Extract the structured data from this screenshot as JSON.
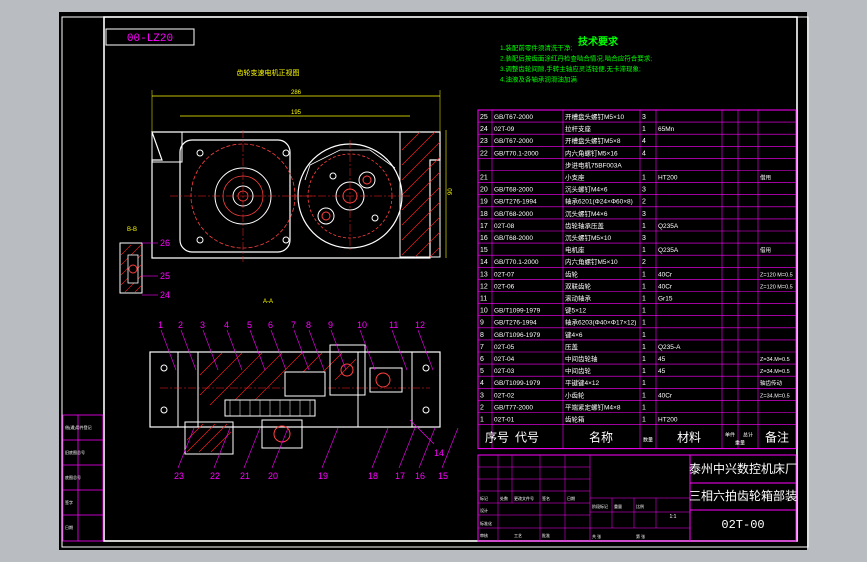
{
  "drawing": {
    "code_box": "00-LZ20",
    "title_note": "齿轮变速电机正视图",
    "tech_title": "技术要求",
    "tech_lines": [
      "1.装配前零件须清洗干净;",
      "2.装配后按齿面涂红丹检查啮合情况,啮合应符合要求;",
      "3.调整齿轮间隙,手转主轴应灵活轻便,无卡滞现象;",
      "4.油液及各轴承润滑油加满"
    ],
    "view_bb": "B-B",
    "view_aa": "A-A",
    "dim_top": "286",
    "dim_mid": "195",
    "dim_left": "90",
    "top_callouts": [
      "1",
      "2",
      "3",
      "4",
      "5",
      "6",
      "7",
      "8",
      "9",
      "10",
      "11",
      "12"
    ],
    "bottom_callouts": [
      "23",
      "22",
      "21",
      "20",
      "19",
      "18",
      "17",
      "16",
      "15"
    ],
    "side_callouts": [
      "14"
    ],
    "bb_callouts": [
      "26",
      "25",
      "24"
    ]
  },
  "bom": {
    "rows": [
      {
        "no": "25",
        "code": "GB/T67-2000",
        "name": "开槽盘头螺钉M5×10",
        "qty": "3",
        "mat": "",
        "note": ""
      },
      {
        "no": "24",
        "code": "02T-09",
        "name": "拉杆支座",
        "qty": "1",
        "mat": "65Mn",
        "note": ""
      },
      {
        "no": "23",
        "code": "GB/T67-2000",
        "name": "开槽盘头螺钉M5×8",
        "qty": "4",
        "mat": "",
        "note": ""
      },
      {
        "no": "22",
        "code": "GB/T70.1-2000",
        "name": "内六角螺钉M5×16",
        "qty": "4",
        "mat": "",
        "note": ""
      },
      {
        "no": "",
        "code": "",
        "name": "步进电机75BF003A",
        "qty": "",
        "mat": "",
        "note": ""
      },
      {
        "no": "21",
        "code": "",
        "name": "小支座",
        "qty": "1",
        "mat": "HT200",
        "note": "借用"
      },
      {
        "no": "20",
        "code": "GB/T68-2000",
        "name": "沉头螺钉M4×6",
        "qty": "3",
        "mat": "",
        "note": ""
      },
      {
        "no": "19",
        "code": "GB/T276-1994",
        "name": "轴承6201(Φ24×Φ60×8)",
        "qty": "2",
        "mat": "",
        "note": ""
      },
      {
        "no": "18",
        "code": "GB/T68-2000",
        "name": "沉头螺钉M4×6",
        "qty": "3",
        "mat": "",
        "note": ""
      },
      {
        "no": "17",
        "code": "02T-08",
        "name": "齿轮轴承压盖",
        "qty": "1",
        "mat": "Q235A",
        "note": ""
      },
      {
        "no": "16",
        "code": "GB/T68-2000",
        "name": "沉头螺钉M5×10",
        "qty": "3",
        "mat": "",
        "note": ""
      },
      {
        "no": "15",
        "code": "",
        "name": "电机座",
        "qty": "1",
        "mat": "Q235A",
        "note": "借用"
      },
      {
        "no": "14",
        "code": "GB/T70.1-2000",
        "name": "内六角螺钉M5×10",
        "qty": "2",
        "mat": "",
        "note": ""
      },
      {
        "no": "13",
        "code": "02T-07",
        "name": "齿轮",
        "qty": "1",
        "mat": "40Cr",
        "note": "Z=120 M=0.5"
      },
      {
        "no": "12",
        "code": "02T-06",
        "name": "双联齿轮",
        "qty": "1",
        "mat": "40Cr",
        "note": "Z=120 M=0.5"
      },
      {
        "no": "11",
        "code": "",
        "name": "滚动轴承",
        "qty": "1",
        "mat": "Gr15",
        "note": ""
      },
      {
        "no": "10",
        "code": "GB/T1099-1979",
        "name": "键5×12",
        "qty": "1",
        "mat": "",
        "note": ""
      },
      {
        "no": "9",
        "code": "GB/T276-1994",
        "name": "轴承6203(Φ40×Φ17×12)",
        "qty": "1",
        "mat": "",
        "note": ""
      },
      {
        "no": "8",
        "code": "GB/T1096-1979",
        "name": "键4×6",
        "qty": "1",
        "mat": "",
        "note": ""
      },
      {
        "no": "7",
        "code": "02T-05",
        "name": "压盖",
        "qty": "1",
        "mat": "Q235-A",
        "note": ""
      },
      {
        "no": "6",
        "code": "02T-04",
        "name": "中间齿轮轴",
        "qty": "1",
        "mat": "45",
        "note": "Z=34.M=0.5"
      },
      {
        "no": "5",
        "code": "02T-03",
        "name": "中间齿轮",
        "qty": "1",
        "mat": "45",
        "note": "Z=34.M=0.5"
      },
      {
        "no": "4",
        "code": "GB/T1099-1979",
        "name": "平键键4×12",
        "qty": "1",
        "mat": "",
        "note": "轴齿传动"
      },
      {
        "no": "3",
        "code": "02T-02",
        "name": "小齿轮",
        "qty": "1",
        "mat": "40Cr",
        "note": "Z=34.M=0.5"
      },
      {
        "no": "2",
        "code": "GB/T77-2000",
        "name": "平端紧定螺钉M4×8",
        "qty": "1",
        "mat": "",
        "note": ""
      },
      {
        "no": "1",
        "code": "02T-01",
        "name": "齿轮箱",
        "qty": "1",
        "mat": "HT200",
        "note": ""
      }
    ],
    "headers": {
      "no": "序号",
      "code": "代号",
      "name": "名称",
      "qty": "数量",
      "mat": "材料",
      "w1": "单件",
      "w2": "总计",
      "wgt": "重量",
      "note": "备注"
    }
  },
  "titleblock": {
    "company": "泰州中兴数控机床厂",
    "assembly": "三相六拍齿轮箱部装",
    "drawing_no": "02T-00",
    "scale": "1:1",
    "small_labels": [
      "标记",
      "处数",
      "更改文件号",
      "签名",
      "日期",
      "设计",
      "标准化",
      "审核",
      "工艺",
      "批准",
      "阶段标记",
      "重量",
      "比例",
      "共 张",
      "第 张"
    ]
  },
  "left_strip": {
    "labels": [
      "借(通)用件登记",
      "旧底图总号",
      "底图总号",
      "签字",
      "日期"
    ]
  },
  "colors": {
    "background": "#000000",
    "frame": "#ffffff",
    "table_lines": "#ff00ff",
    "bom_text": "#ffffff",
    "hatch": "#ff0000",
    "circles": "#ff4040",
    "green_text": "#00ff00",
    "centerline": "#ff2020",
    "callout": "#ff00ff",
    "body_outline": "#ffffff"
  }
}
